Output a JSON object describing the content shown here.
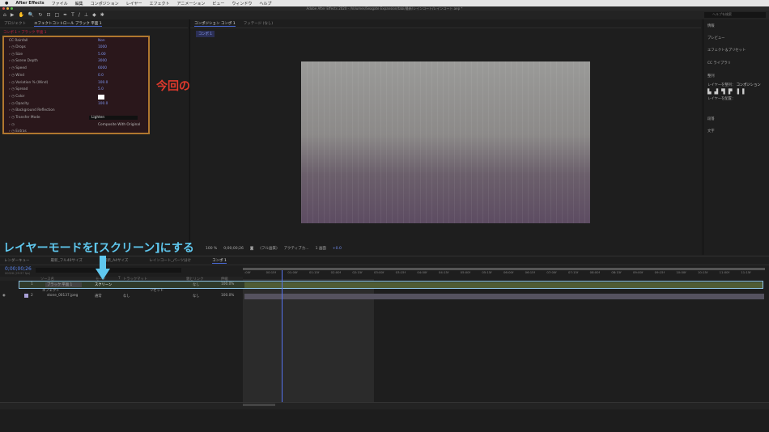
{
  "menubar": {
    "app": "After Effects",
    "items": [
      "ファイル",
      "編集",
      "コンポジション",
      "レイヤー",
      "エフェクト",
      "アニメーション",
      "ビュー",
      "ウィンドウ",
      "ヘルプ"
    ]
  },
  "window_title": "Adobe After Effects 2020 - /Volumes/Seagate Expansion/tabi/最新/レインコート/レインコート.aep *",
  "left_panel": {
    "tabs": [
      "プロジェクト",
      "エフェクトコントロール ブラック 平面 1"
    ],
    "breadcrumb": "コンポ 1 • ブラック 平面 1",
    "effect": {
      "name": "CC Rainfall",
      "reset": "Non",
      "props": [
        {
          "label": "Drops",
          "value": "1000"
        },
        {
          "label": "Size",
          "value": "5.00"
        },
        {
          "label": "Scene Depth",
          "value": "3000"
        },
        {
          "label": "Speed",
          "value": "6000"
        },
        {
          "label": "Wind",
          "value": "0.0"
        },
        {
          "label": "Variation % (Wind)",
          "value": "100.0"
        },
        {
          "label": "Spread",
          "value": "5.0"
        },
        {
          "label": "Color",
          "value": ""
        },
        {
          "label": "Opacity",
          "value": "100.0"
        },
        {
          "label": "Background Reflection",
          "value": ""
        },
        {
          "label": "Transfer Mode",
          "value": "Lighten"
        },
        {
          "label": "",
          "value": "Composite With Original"
        },
        {
          "label": "Extras",
          "value": ""
        }
      ]
    }
  },
  "annotations": {
    "effect_note": "今回の雨エフェクトの設定",
    "mode_note": "レイヤーモードを[スクリーン]にする"
  },
  "comp_panel": {
    "tabs": [
      "コンポジション コンポ 1",
      "フッテージ (なし)"
    ],
    "sub_tab": "コンポ 1",
    "viewer": {
      "zoom": "100 %",
      "timecode": "0;00;00;26",
      "resolution": "(フル画質)",
      "camera": "アクティブカ...",
      "views": "1 画面",
      "offset": "+0.0"
    }
  },
  "right_panel": {
    "items": [
      "情報",
      "プレビュー",
      "エフェクト＆プリセット",
      "CC ライブラリ",
      "整列",
      "段落",
      "文字"
    ],
    "search_placeholder": "ヘルプを検索",
    "align_to_label": "レイヤーを整列：",
    "align_to_value": "コンポジション",
    "distribute_label": "レイヤーを配置："
  },
  "timeline": {
    "tabs": [
      "レンダーキュー",
      "最新_フル40サイズ",
      "最新_A4サイズ",
      "レインコート_パーツ分け",
      "コンポ 1"
    ],
    "timecode": "0;00;00;26",
    "fps": "00026 (29.97 fps)",
    "headers": [
      "ソース名",
      "モード",
      "T",
      "トラックマット",
      "親とリンク",
      "伸縮"
    ],
    "layers": [
      {
        "num": "1",
        "name": "ブラック 平面 1",
        "mode": "スクリーン",
        "parent": "なし",
        "stretch": "100.0%",
        "sub": "エフェクト",
        "sub_val": "リセット"
      },
      {
        "num": "2",
        "name": "stone_00137.jpeg",
        "mode": "通常",
        "matte": "なし",
        "parent": "なし",
        "stretch": "100.0%"
      }
    ],
    "ruler": [
      ":00f",
      "00:15f",
      "01:00f",
      "01:15f",
      "02:00f",
      "02:15f",
      "03:00f",
      "03:15f",
      "04:00f",
      "04:15f",
      "05:00f",
      "05:15f",
      "06:00f",
      "06:15f",
      "07:00f",
      "07:15f",
      "08:00f",
      "08:15f",
      "09:00f",
      "09:15f",
      "10:00f",
      "10:15f",
      "11:00f",
      "11:15f"
    ]
  }
}
